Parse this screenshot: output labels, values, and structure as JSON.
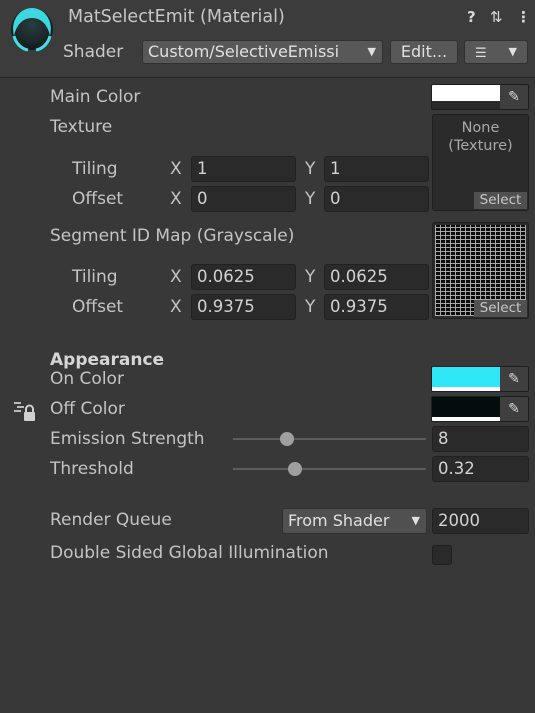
{
  "header": {
    "title": "MatSelectEmit (Material)",
    "shader_label": "Shader",
    "shader_value": "Custom/SelectiveEmissi",
    "edit_label": "Edit...",
    "help_icon": "?",
    "settings_icon": "⇅",
    "menu_icon": "⋮",
    "list_icon": "☰"
  },
  "props": {
    "main_color": {
      "label": "Main Color",
      "color": "#ffffff"
    },
    "texture": {
      "label": "Texture",
      "slot_none": "None",
      "slot_type": "(Texture)",
      "select": "Select",
      "tiling_label": "Tiling",
      "offset_label": "Offset",
      "x": "X",
      "y": "Y",
      "tiling_x": "1",
      "tiling_y": "1",
      "offset_x": "0",
      "offset_y": "0"
    },
    "segment": {
      "label": "Segment ID Map (Grayscale)",
      "select": "Select",
      "tiling_label": "Tiling",
      "offset_label": "Offset",
      "x": "X",
      "y": "Y",
      "tiling_x": "0.0625",
      "tiling_y": "0.0625",
      "offset_x": "0.9375",
      "offset_y": "0.9375"
    },
    "appearance_header": "Appearance",
    "on_color": {
      "label": "On Color",
      "color": "#2ee8f8"
    },
    "off_color": {
      "label": "Off Color",
      "color": "#040d0e"
    },
    "emission_strength": {
      "label": "Emission Strength",
      "value": "8",
      "fraction": 0.28
    },
    "threshold": {
      "label": "Threshold",
      "value": "0.32",
      "fraction": 0.32
    },
    "render_queue": {
      "label": "Render Queue",
      "dropdown": "From Shader",
      "value": "2000"
    },
    "dsgi": {
      "label": "Double Sided Global Illumination",
      "checked": false
    }
  },
  "colors": {
    "background": "#383838",
    "header": "#3c3c3c",
    "field": "#2a2a2a",
    "accent_cyan": "#2ee8f8"
  }
}
